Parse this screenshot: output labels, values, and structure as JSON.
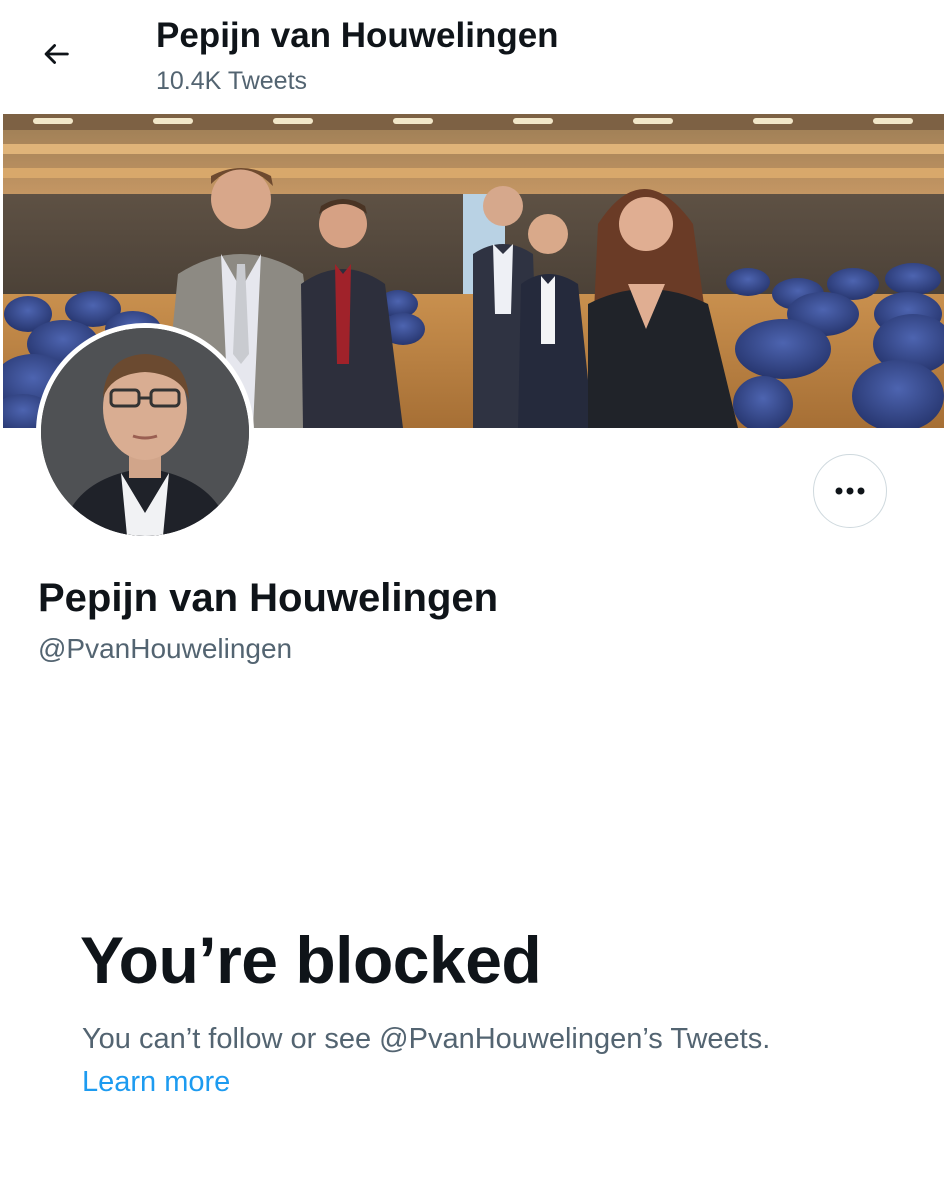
{
  "header": {
    "title": "Pepijn van Houwelingen",
    "tweet_count": "10.4K Tweets",
    "back_icon": "arrow-left-icon"
  },
  "profile": {
    "display_name": "Pepijn van Houwelingen",
    "handle": "@PvanHouwelingen",
    "more_icon": "ellipsis-icon"
  },
  "blocked": {
    "title": "You’re blocked",
    "description": "You can’t follow or see @PvanHouwelingen’s Tweets.",
    "learn_more": "Learn more"
  },
  "colors": {
    "primary_text": "#0f1419",
    "secondary_text": "#536471",
    "link": "#1d9bf0",
    "border": "#cfd9de"
  }
}
